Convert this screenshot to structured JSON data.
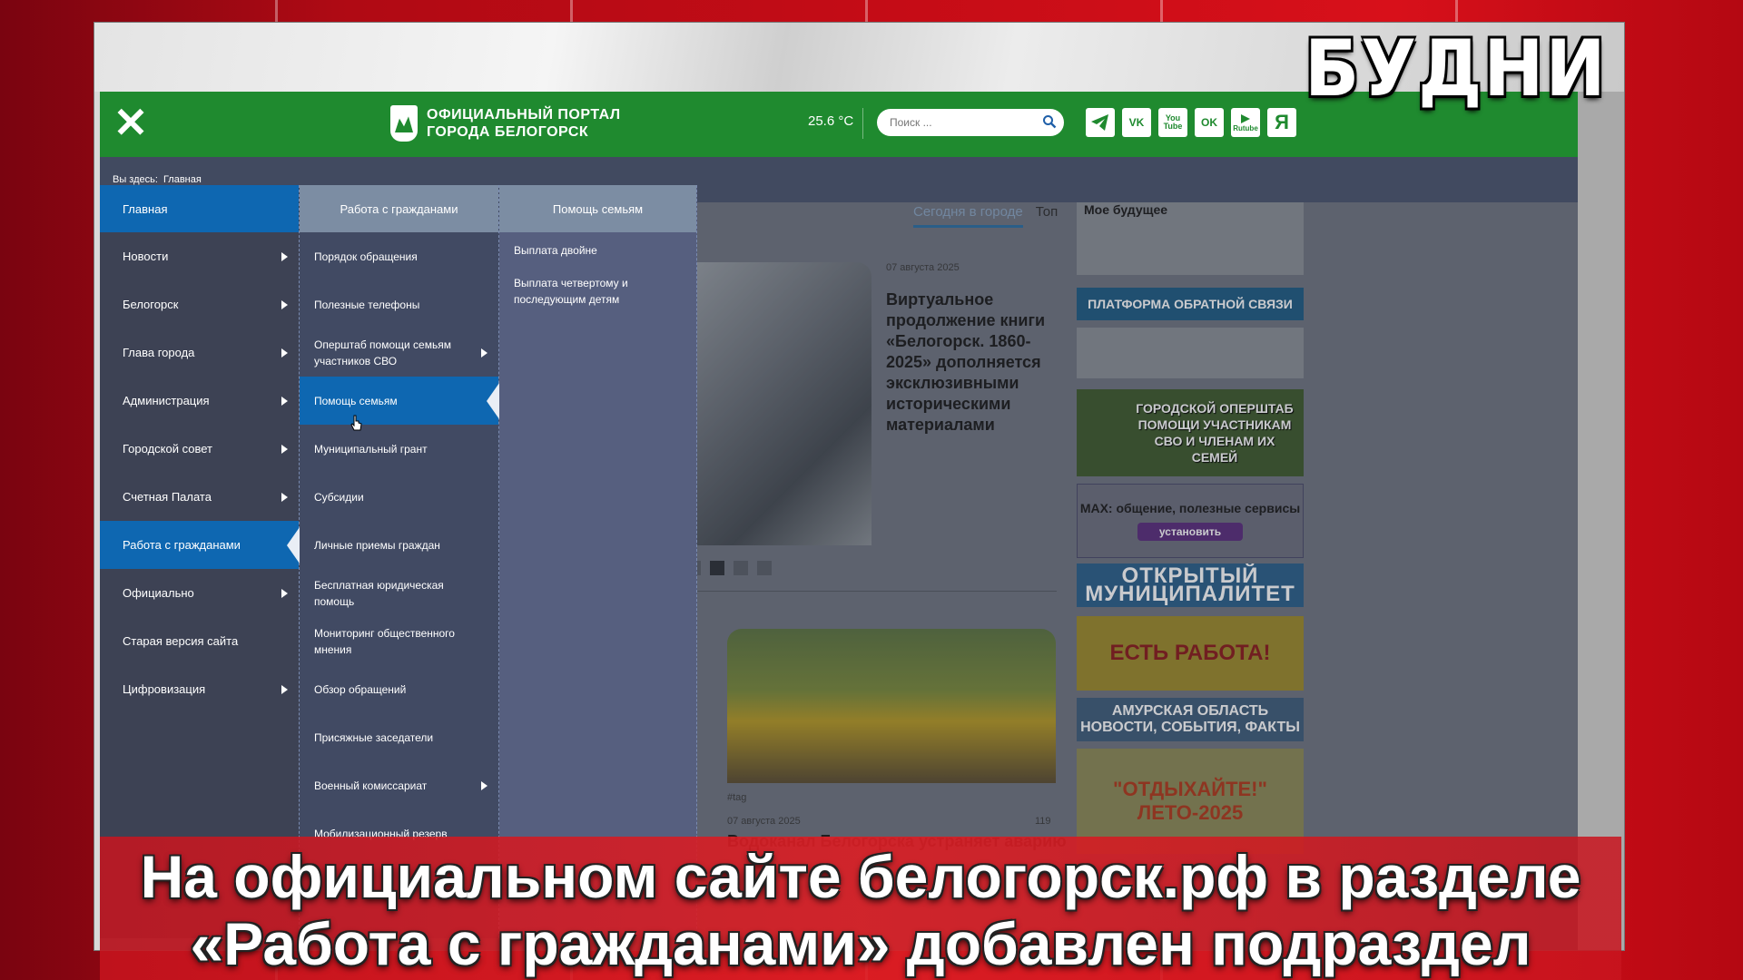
{
  "channel": {
    "logo_text": "БУДНИ"
  },
  "site": {
    "logo_line1": "ОФИЦИАЛЬНЫЙ ПОРТАЛ",
    "logo_line2": "ГОРОДА БЕЛОГОРСК",
    "temperature": "25.6 °C",
    "search_placeholder": "Поиск ...",
    "social": [
      {
        "icon": "telegram-icon",
        "label": ""
      },
      {
        "icon": "vk-icon",
        "label": "VK"
      },
      {
        "icon": "youtube-icon",
        "label": "You Tube"
      },
      {
        "icon": "odnoklassniki-icon",
        "label": "OK"
      },
      {
        "icon": "rutube-icon",
        "label": "Rutube"
      },
      {
        "icon": "yandex-icon",
        "label": "Я"
      }
    ]
  },
  "breadcrumb": {
    "prefix": "Вы здесь:",
    "current": "Главная"
  },
  "menu": {
    "col1": {
      "head": "Главная",
      "items": [
        {
          "label": "Новости",
          "has_sub": true
        },
        {
          "label": "Белогорск",
          "has_sub": true
        },
        {
          "label": "Глава города",
          "has_sub": true
        },
        {
          "label": "Администрация",
          "has_sub": true
        },
        {
          "label": "Городской совет",
          "has_sub": true
        },
        {
          "label": "Счетная Палата",
          "has_sub": true
        },
        {
          "label": "Работа с гражданами",
          "active": true
        },
        {
          "label": "Официально",
          "has_sub": true
        },
        {
          "label": "Старая версия сайта",
          "has_sub": false
        },
        {
          "label": "Цифровизация",
          "has_sub": true
        }
      ]
    },
    "col2": {
      "head": "Работа с гражданами",
      "items": [
        {
          "label": "Порядок обращения"
        },
        {
          "label": "Полезные телефоны"
        },
        {
          "label": "Оперштаб помощи семьям участников СВО",
          "has_sub": true
        },
        {
          "label": "Помощь семьям",
          "active": true
        },
        {
          "label": "Муниципальный грант"
        },
        {
          "label": "Субсидии"
        },
        {
          "label": "Личные приемы граждан"
        },
        {
          "label": "Бесплатная юридическая помощь"
        },
        {
          "label": "Мониторинг общественного мнения"
        },
        {
          "label": "Обзор обращений"
        },
        {
          "label": "Присяжные заседатели"
        },
        {
          "label": "Военный комиссариат",
          "has_sub": true
        },
        {
          "label": "Мобилизационный резерв"
        }
      ]
    },
    "col3": {
      "head": "Помощь семьям",
      "items": [
        {
          "label": "Выплата двойне"
        },
        {
          "label": "Выплата четвертому и последующим детям"
        }
      ]
    }
  },
  "content": {
    "tab_active": "Сегодня в городе",
    "tab_other": "Топ",
    "news1_date": "07 августа 2025",
    "news1_title": "Виртуальное продолжение книги «Белогорск. 1860-2025» дополняется эксклюзивными историческими материалами",
    "news2_tag": "#tag",
    "news2_date": "07 августа 2025",
    "news2_views": "119",
    "news2_title": "Водоканал Белогорска устраняет аварию"
  },
  "banners": {
    "b1": "Мое будущее",
    "b2": "ПЛАТФОРМА ОБРАТНОЙ СВЯЗИ",
    "b4": "ГОРОДСКОЙ ОПЕРШТАБ ПОМОЩИ УЧАСТНИКАМ СВО И ЧЛЕНАМ ИХ СЕМЕЙ",
    "b5_title": "MAX: общение, полезные сервисы",
    "b5_button": "установить",
    "b6": "ОТКРЫТЫЙ МУНИЦИПАЛИТЕТ",
    "b7": "ЕСТЬ РАБОТА!",
    "b8": "АМУРСКАЯ ОБЛАСТЬ НОВОСТИ, СОБЫТИЯ, ФАКТЫ",
    "b9": "\"ОТДЫХАЙТЕ!\" ЛЕТО-2025"
  },
  "caption": {
    "line1": "На официальном сайте белогорск.рф в разделе",
    "line2": "«Работа с гражданами» добавлен подраздел"
  }
}
